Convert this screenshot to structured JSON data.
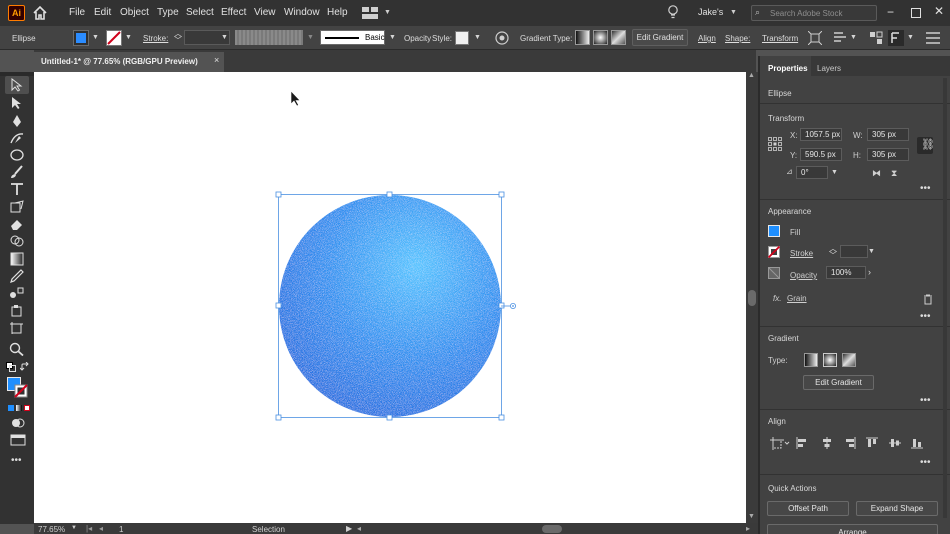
{
  "app": {
    "logo": "Ai",
    "menu": [
      "File",
      "Edit",
      "Object",
      "Type",
      "Select",
      "Effect",
      "View",
      "Window",
      "Help"
    ],
    "user": "Jake's",
    "search_placeholder": "Search Adobe Stock"
  },
  "control": {
    "object_type": "Ellipse",
    "stroke_label": "Stroke:",
    "brush_style": "Basic",
    "opacity_label": "Opacity",
    "style_label": "Style:",
    "gradient_type_label": "Gradient Type:",
    "edit_gradient": "Edit Gradient",
    "align": "Align",
    "shape": "Shape:",
    "transform": "Transform"
  },
  "document": {
    "tab_title": "Untitled-1* @ 77.65% (RGB/GPU Preview)",
    "close": "×"
  },
  "status": {
    "zoom": "77.65%",
    "artboard": "1",
    "mode": "Selection"
  },
  "panel": {
    "tabs": [
      "Properties",
      "Layers"
    ],
    "object_type": "Ellipse",
    "transform": {
      "title": "Transform",
      "x_label": "X:",
      "x": "1057.5 px",
      "y_label": "Y:",
      "y": "590.5 px",
      "w_label": "W:",
      "w": "305 px",
      "h_label": "H:",
      "h": "305 px",
      "angle": "0°"
    },
    "appearance": {
      "title": "Appearance",
      "fill": "Fill",
      "stroke": "Stroke",
      "opacity": "Opacity",
      "opacity_value": "100%",
      "effect_prefix": "fx.",
      "effect": "Grain"
    },
    "gradient": {
      "title": "Gradient",
      "type_label": "Type:",
      "edit": "Edit Gradient"
    },
    "align": {
      "title": "Align"
    },
    "quick_actions": {
      "title": "Quick Actions",
      "offset_path": "Offset Path",
      "expand_shape": "Expand Shape",
      "arrange": "Arrange"
    },
    "more": "•••"
  },
  "colors": {
    "fill": "#1f8fff",
    "accent": "#4a90e2",
    "stroke_swatch": "#c0392b"
  }
}
